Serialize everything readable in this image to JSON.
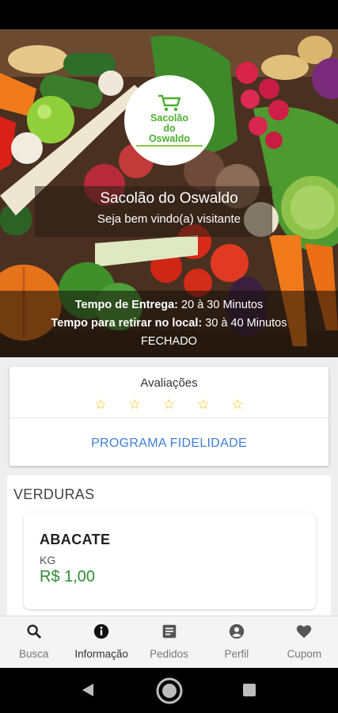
{
  "store": {
    "name": "Sacolão do Oswaldo",
    "welcome": "Seja bem vindo(a) visitante",
    "logo_line1": "Sacolão",
    "logo_line2": "do",
    "logo_line3": "Oswaldo"
  },
  "delivery": {
    "delivery_label": "Tempo de Entrega:",
    "delivery_value": "20 à 30 Minutos",
    "pickup_label": "Tempo para retirar no local:",
    "pickup_value": "30 à 40 Minutos",
    "status": "FECHADO"
  },
  "ratings": {
    "title": "Avaliações",
    "stars": 0,
    "max_stars": 5,
    "loyalty_label": "PROGRAMA FIDELIDADE"
  },
  "category": {
    "title": "VERDURAS",
    "products": [
      {
        "name": "ABACATE",
        "unit": "KG",
        "price": "R$ 1,00"
      }
    ]
  },
  "bottom_nav": {
    "items": [
      {
        "label": "Busca",
        "icon": "search-icon"
      },
      {
        "label": "Informação",
        "icon": "info-icon"
      },
      {
        "label": "Pedidos",
        "icon": "orders-icon"
      },
      {
        "label": "Perfil",
        "icon": "profile-icon"
      },
      {
        "label": "Cupom",
        "icon": "heart-icon"
      }
    ],
    "active_index": 1
  },
  "colors": {
    "accent_blue": "#3f7fd6",
    "price_green": "#2e8b34",
    "star_yellow": "#f5b800",
    "logo_green": "#4caf2f"
  }
}
